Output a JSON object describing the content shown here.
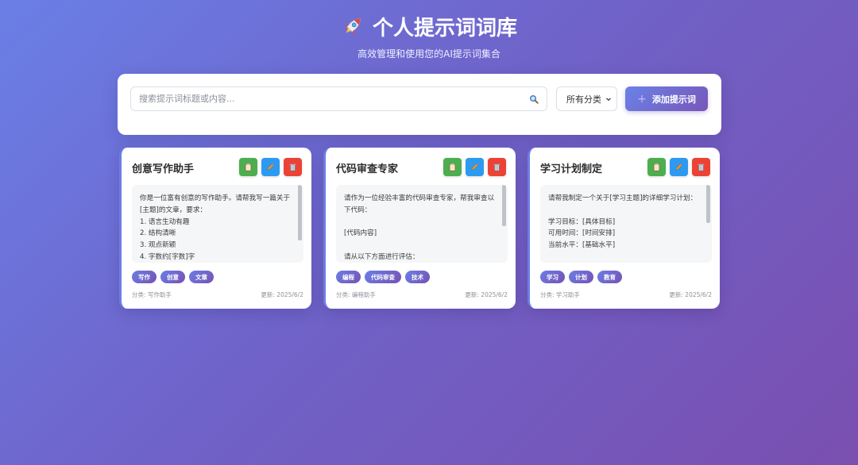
{
  "header": {
    "title": "个人提示词词库",
    "subtitle": "高效管理和使用您的AI提示词集合"
  },
  "search": {
    "placeholder": "搜索提示词标题或内容...",
    "category_selected": "所有分类",
    "add_label": "添加提示词"
  },
  "cards": [
    {
      "title": "创意写作助手",
      "content": "你是一位富有创意的写作助手。请帮我写一篇关于[主题]的文章，要求：\n1. 语言生动有趣\n2. 结构清晰\n3. 观点新颖\n4. 字数约[字数]字",
      "tags": [
        "写作",
        "创意",
        "文章"
      ],
      "category": "分类: 写作助手",
      "updated": "更新: 2025/6/2"
    },
    {
      "title": "代码审查专家",
      "content": "请作为一位经验丰富的代码审查专家，帮我审查以下代码：\n\n[代码内容]\n\n请从以下方面进行评估：",
      "tags": [
        "编程",
        "代码审查",
        "技术"
      ],
      "category": "分类: 编程助手",
      "updated": "更新: 2025/6/2"
    },
    {
      "title": "学习计划制定",
      "content": "请帮我制定一个关于[学习主题]的详细学习计划：\n\n学习目标：[具体目标]\n可用时间：[时间安排]\n当前水平：[基础水平]",
      "tags": [
        "学习",
        "计划",
        "教育"
      ],
      "category": "分类: 学习助手",
      "updated": "更新: 2025/6/2"
    }
  ],
  "colors": {
    "copy": "#4cae4f",
    "edit": "#2d9af0",
    "delete": "#ec4236",
    "accent": "#6c7ee3"
  }
}
